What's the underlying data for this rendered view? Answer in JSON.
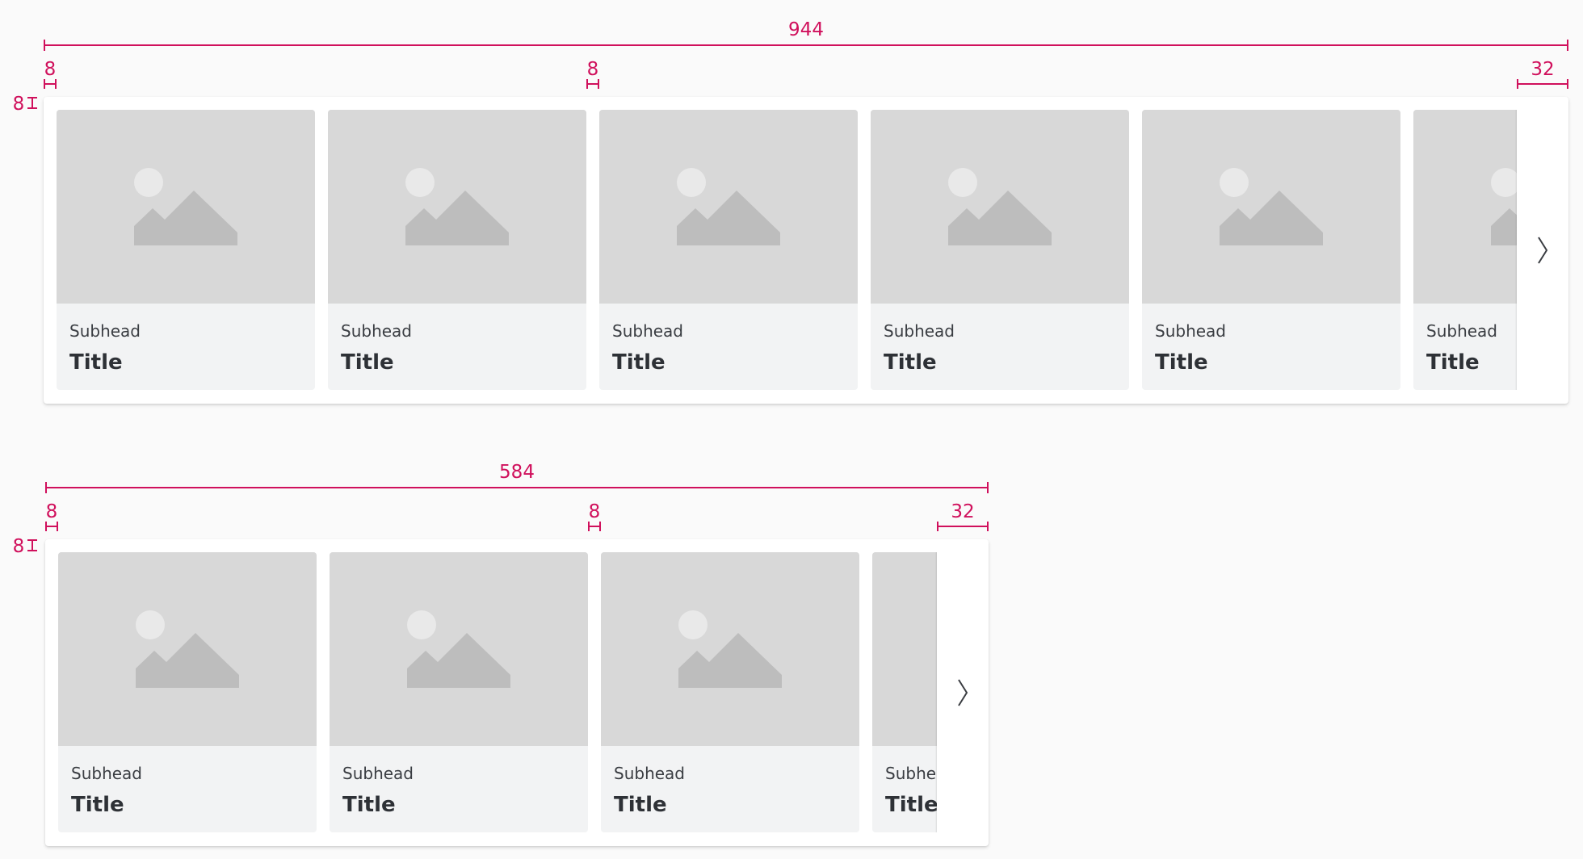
{
  "dimensions": {
    "wide": {
      "total": "944",
      "start_padding": "8",
      "gap": "8",
      "end_padding": "32",
      "top_padding": "8"
    },
    "narrow": {
      "total": "584",
      "start_padding": "8",
      "gap": "8",
      "end_padding": "32",
      "top_padding": "8"
    }
  },
  "carousels": [
    {
      "cards": [
        {
          "subhead": "Subhead",
          "title": "Title"
        },
        {
          "subhead": "Subhead",
          "title": "Title"
        },
        {
          "subhead": "Subhead",
          "title": "Title"
        },
        {
          "subhead": "Subhead",
          "title": "Title"
        },
        {
          "subhead": "Subhead",
          "title": "Title"
        },
        {
          "subhead": "Subhead",
          "title": "Title"
        }
      ]
    },
    {
      "cards": [
        {
          "subhead": "Subhead",
          "title": "Title"
        },
        {
          "subhead": "Subhead",
          "title": "Title"
        },
        {
          "subhead": "Subhead",
          "title": "Title"
        },
        {
          "subhead": "Subhead",
          "title": "Title"
        }
      ]
    }
  ],
  "icons": {
    "next": "chevron-right-icon",
    "media": "image-placeholder-icon"
  },
  "colors": {
    "annotation": "#d0105c",
    "card_background": "#f2f3f4",
    "media_placeholder": "#d8d8d8",
    "placeholder_shape": "#bdbdbd"
  }
}
